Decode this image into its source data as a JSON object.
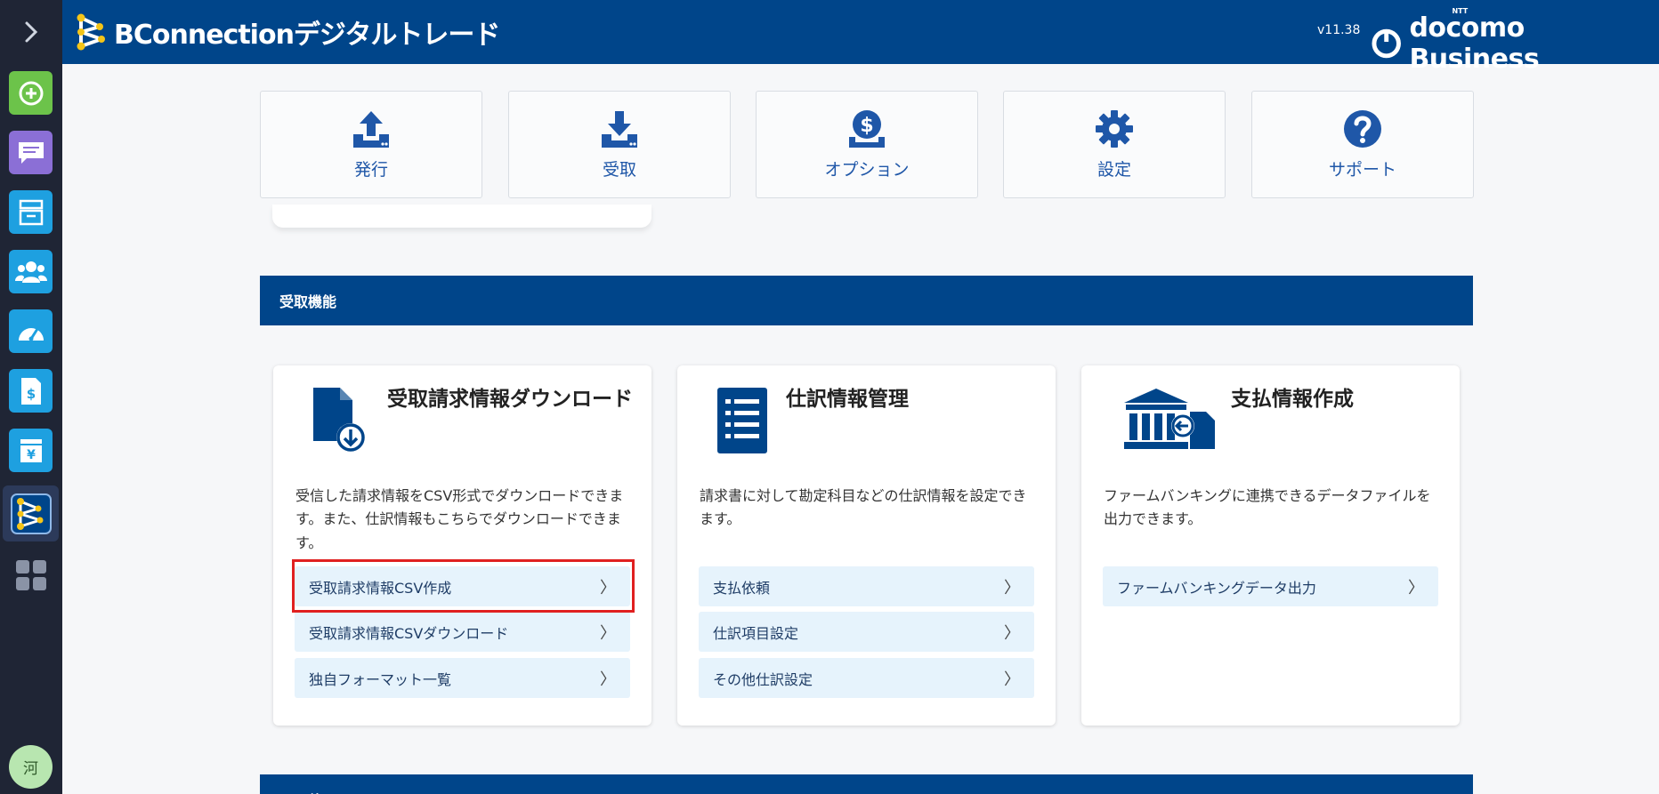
{
  "sidebar": {
    "avatar_label": "河",
    "items": [
      {
        "name": "add-icon",
        "color": "#6cc34a"
      },
      {
        "name": "messages-icon",
        "color": "#8b6fd6"
      },
      {
        "name": "inbox-icon",
        "color": "#1ea0e0"
      },
      {
        "name": "users-icon",
        "color": "#1ea0e0"
      },
      {
        "name": "dashboard-icon",
        "color": "#1ea0e0"
      },
      {
        "name": "invoice-icon",
        "color": "#1ea0e0"
      },
      {
        "name": "yen-icon",
        "color": "#1ea0e0"
      },
      {
        "name": "bconnection-icon",
        "color": "#2c3a5a"
      },
      {
        "name": "apps-grid-icon",
        "color": "#8a93a6"
      }
    ]
  },
  "header": {
    "brand": "BConnectionデジタルトレード",
    "version": "v11.38",
    "partner_small": "NTT",
    "partner": "docomo Business"
  },
  "tiles": [
    {
      "label": "発行",
      "icon": "upload-icon"
    },
    {
      "label": "受取",
      "icon": "download-icon"
    },
    {
      "label": "オプション",
      "icon": "dollar-coin-icon"
    },
    {
      "label": "設定",
      "icon": "gear-icon"
    },
    {
      "label": "サポート",
      "icon": "question-icon"
    }
  ],
  "sections": {
    "receive": "受取機能",
    "other": "その他"
  },
  "cards": [
    {
      "title": "受取請求情報ダウンロード",
      "icon": "file-download-icon",
      "desc": "受信した請求情報をCSV形式でダウンロードできます。また、仕訳情報もこちらでダウンロードできます。",
      "links": [
        "受取請求情報CSV作成",
        "受取請求情報CSVダウンロード",
        "独自フォーマット一覧"
      ]
    },
    {
      "title": "仕訳情報管理",
      "icon": "list-document-icon",
      "desc": "請求書に対して勘定科目などの仕訳情報を設定できます。",
      "links": [
        "支払依頼",
        "仕訳項目設定",
        "その他仕訳設定"
      ]
    },
    {
      "title": "支払情報作成",
      "icon": "bank-transfer-icon",
      "desc": "ファームバンキングに連携できるデータファイルを出力できます。",
      "links": [
        "ファームバンキングデータ出力"
      ]
    }
  ],
  "chevron": "〉"
}
